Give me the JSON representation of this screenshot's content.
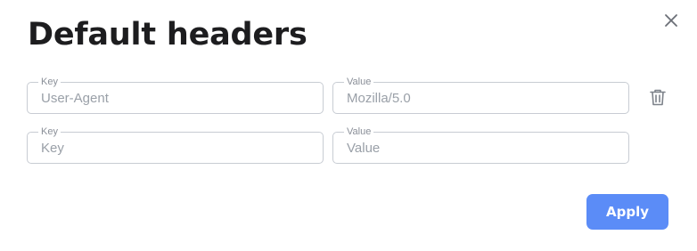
{
  "dialog": {
    "title": "Default headers",
    "close_icon": "close-icon",
    "apply_label": "Apply",
    "accent_color": "#5b8cf7"
  },
  "headers": [
    {
      "key_label": "Key",
      "key_value": "",
      "key_placeholder": "User-Agent",
      "value_label": "Value",
      "value_value": "",
      "value_placeholder": "Mozilla/5.0",
      "delete_icon": "trash-icon"
    },
    {
      "key_label": "Key",
      "key_value": "",
      "key_placeholder": "Key",
      "value_label": "Value",
      "value_value": "",
      "value_placeholder": "Value"
    }
  ]
}
